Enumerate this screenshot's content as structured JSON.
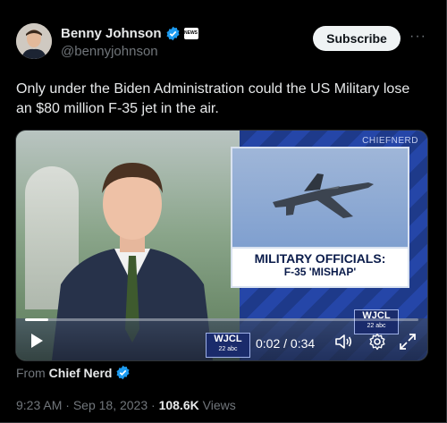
{
  "author": {
    "name": "Benny Johnson",
    "handle": "@bennyjohnson",
    "affiliation_badge_text": "NEWS"
  },
  "actions": {
    "subscribe_label": "Subscribe",
    "more_label": "···"
  },
  "tweet": {
    "text": "Only under the Biden Administration could the US Military lose an $80 million F-35 jet in the air."
  },
  "video": {
    "watermark": "CHIEFNERD",
    "lower_third_line1": "MILITARY OFFICIALS:",
    "lower_third_line2": "F-35 'MISHAP'",
    "station_logo": "WJCL",
    "station_logo_sub": "22 abc",
    "current_time": "0:02",
    "duration": "0:34",
    "time_display": "0:02 / 0:34",
    "progress_fraction": 0.06
  },
  "source": {
    "prefix": "From",
    "name": "Chief Nerd"
  },
  "meta": {
    "time": "9:23 AM",
    "date": "Sep 18, 2023",
    "sep": "·",
    "views_count": "108.6K",
    "views_label": "Views"
  },
  "colors": {
    "background": "#000000",
    "verified_blue": "#1d9bf0",
    "subscribe_bg": "#eff3f4",
    "secondary_text": "#71767b"
  }
}
